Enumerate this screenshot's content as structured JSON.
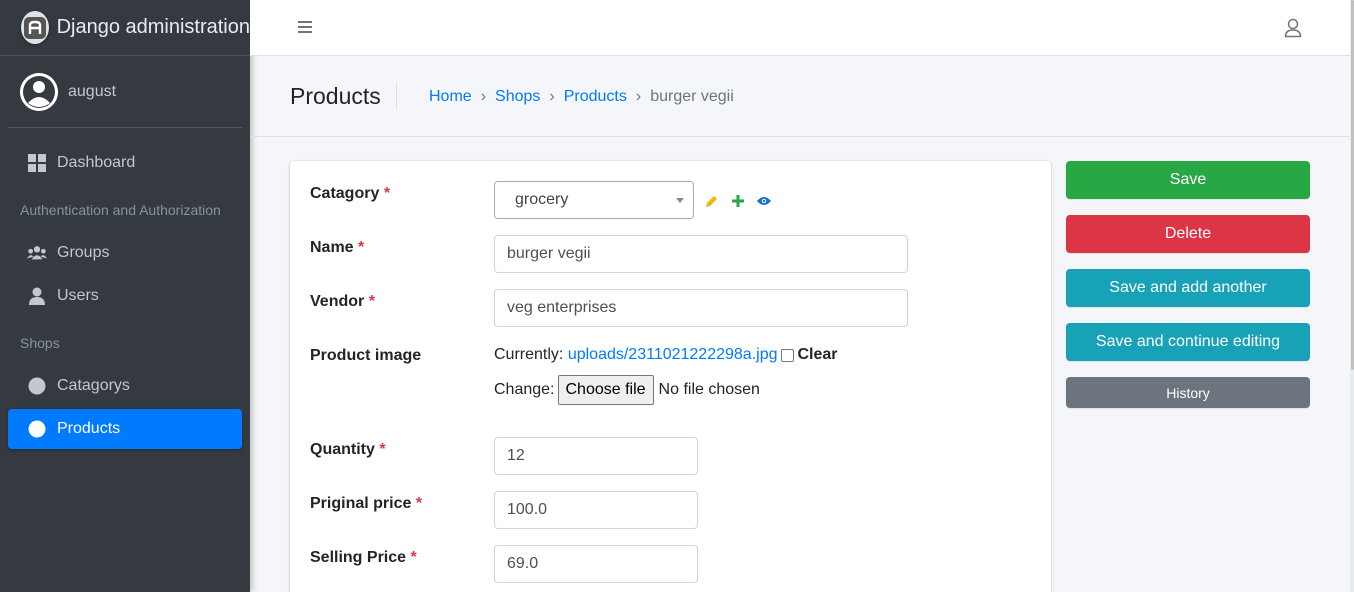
{
  "brand": {
    "title": "Django administration"
  },
  "user": {
    "name": "august"
  },
  "sidebar": {
    "dashboard": "Dashboard",
    "sections": [
      {
        "header": "Authentication and Authorization",
        "items": [
          {
            "label": "Groups"
          },
          {
            "label": "Users"
          }
        ]
      },
      {
        "header": "Shops",
        "items": [
          {
            "label": "Catagorys"
          },
          {
            "label": "Products"
          }
        ]
      }
    ]
  },
  "header": {
    "title": "Products",
    "breadcrumb": [
      "Home",
      "Shops",
      "Products",
      "burger vegii"
    ]
  },
  "form": {
    "catagory": {
      "label": "Catagory",
      "required": "*",
      "value": "grocery"
    },
    "name": {
      "label": "Name",
      "required": "*",
      "value": "burger vegii"
    },
    "vendor": {
      "label": "Vendor",
      "required": "*",
      "value": "veg enterprises"
    },
    "product_image": {
      "label": "Product image",
      "currently_label": "Currently:",
      "current_file": "uploads/2311021222298a.jpg",
      "clear_label": "Clear",
      "change_label": "Change:",
      "choose_file": "Choose file",
      "no_file": "No file chosen"
    },
    "quantity": {
      "label": "Quantity",
      "required": "*",
      "value": "12"
    },
    "original_price": {
      "label": "Priginal price",
      "required": "*",
      "value": "100.0"
    },
    "selling_price": {
      "label": "Selling Price",
      "required": "*",
      "value": "69.0"
    }
  },
  "actions": {
    "save": "Save",
    "delete": "Delete",
    "save_add_another": "Save and add another",
    "save_continue": "Save and continue editing",
    "history": "History"
  },
  "colors": {
    "sidebar_bg": "#343a40",
    "active_nav": "#007bff",
    "save": "#28a745",
    "delete": "#dc3545",
    "info": "#17a2b8",
    "history": "#6c757d",
    "link": "#007bff"
  }
}
